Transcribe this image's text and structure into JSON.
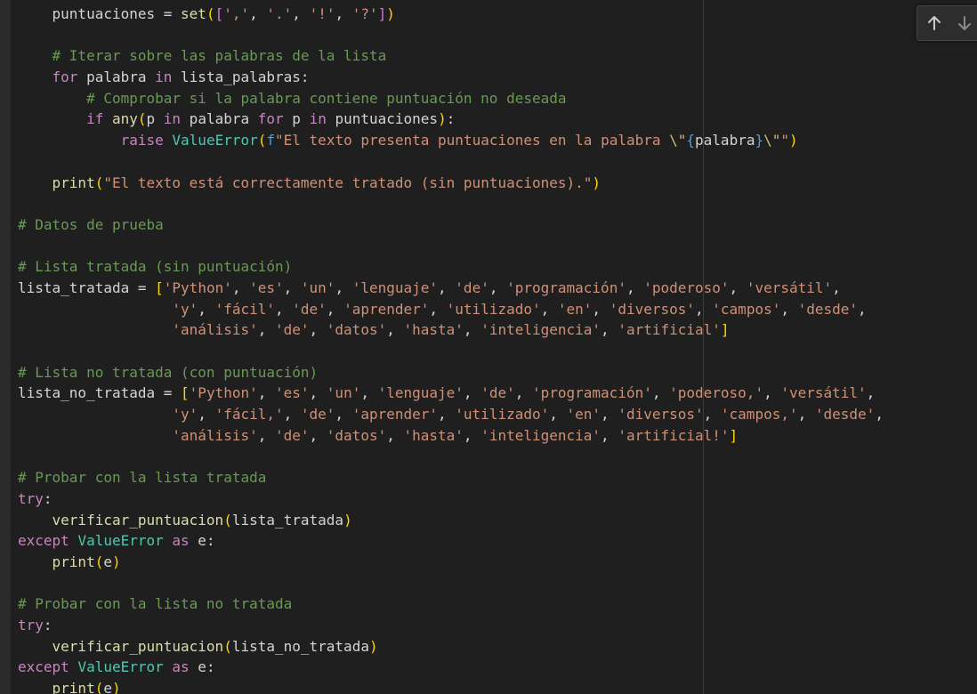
{
  "editor": {
    "lines": [
      [
        [
          "    ",
          ""
        ],
        [
          "puntuaciones",
          "t-v"
        ],
        [
          " = ",
          "t-p"
        ],
        [
          "set",
          "t-f"
        ],
        [
          "(",
          "t-b1"
        ],
        [
          "[",
          "t-b2"
        ],
        [
          "','",
          "t-s"
        ],
        [
          ", ",
          "t-p"
        ],
        [
          "'.'",
          "t-s"
        ],
        [
          ", ",
          "t-p"
        ],
        [
          "'!'",
          "t-s"
        ],
        [
          ", ",
          "t-p"
        ],
        [
          "'?'",
          "t-s"
        ],
        [
          "]",
          "t-b2"
        ],
        [
          ")",
          "t-b1"
        ]
      ],
      [],
      [
        [
          "    ",
          ""
        ],
        [
          "# Iterar sobre las palabras de la lista",
          "t-c"
        ]
      ],
      [
        [
          "    ",
          ""
        ],
        [
          "for",
          "t-cf"
        ],
        [
          " palabra ",
          "t-v"
        ],
        [
          "in",
          "t-cf"
        ],
        [
          " lista_palabras:",
          "t-v"
        ]
      ],
      [
        [
          "        ",
          ""
        ],
        [
          "# Comprobar si la palabra contiene puntuación no deseada",
          "t-c"
        ]
      ],
      [
        [
          "        ",
          ""
        ],
        [
          "if",
          "t-cf"
        ],
        [
          " ",
          ""
        ],
        [
          "any",
          "t-f"
        ],
        [
          "(",
          "t-b1"
        ],
        [
          "p ",
          "t-v"
        ],
        [
          "in",
          "t-cf"
        ],
        [
          " palabra ",
          "t-v"
        ],
        [
          "for",
          "t-cf"
        ],
        [
          " p ",
          "t-v"
        ],
        [
          "in",
          "t-cf"
        ],
        [
          " puntuaciones",
          "t-v"
        ],
        [
          ")",
          "t-b1"
        ],
        [
          ":",
          "t-p"
        ]
      ],
      [
        [
          "            ",
          ""
        ],
        [
          "raise",
          "t-cf"
        ],
        [
          " ",
          ""
        ],
        [
          "ValueError",
          "t-cl"
        ],
        [
          "(",
          "t-b1"
        ],
        [
          "f",
          "t-k"
        ],
        [
          "\"El texto presenta puntuaciones en la palabra ",
          "t-s"
        ],
        [
          "\\\"",
          "t-e"
        ],
        [
          "{",
          "t-k"
        ],
        [
          "palabra",
          "t-v"
        ],
        [
          "}",
          "t-k"
        ],
        [
          "\\\"",
          "t-e"
        ],
        [
          "\"",
          "t-s"
        ],
        [
          ")",
          "t-b1"
        ]
      ],
      [],
      [
        [
          "    ",
          ""
        ],
        [
          "print",
          "t-f"
        ],
        [
          "(",
          "t-b1"
        ],
        [
          "\"El texto está correctamente tratado (sin puntuaciones).\"",
          "t-s"
        ],
        [
          ")",
          "t-b1"
        ]
      ],
      [],
      [
        [
          "# Datos de prueba",
          "t-c"
        ]
      ],
      [],
      [
        [
          "# Lista tratada (sin puntuación)",
          "t-c"
        ]
      ],
      [
        [
          "lista_tratada",
          "t-v"
        ],
        [
          " = ",
          "t-p"
        ],
        [
          "[",
          "t-b1"
        ],
        [
          "'Python'",
          "t-s"
        ],
        [
          ", ",
          "t-p"
        ],
        [
          "'es'",
          "t-s"
        ],
        [
          ", ",
          "t-p"
        ],
        [
          "'un'",
          "t-s"
        ],
        [
          ", ",
          "t-p"
        ],
        [
          "'lenguaje'",
          "t-s"
        ],
        [
          ", ",
          "t-p"
        ],
        [
          "'de'",
          "t-s"
        ],
        [
          ", ",
          "t-p"
        ],
        [
          "'programación'",
          "t-s"
        ],
        [
          ", ",
          "t-p"
        ],
        [
          "'poderoso'",
          "t-s"
        ],
        [
          ", ",
          "t-p"
        ],
        [
          "'versátil'",
          "t-s"
        ],
        [
          ",",
          "t-p"
        ]
      ],
      [
        [
          "                  ",
          ""
        ],
        [
          "'y'",
          "t-s"
        ],
        [
          ", ",
          "t-p"
        ],
        [
          "'fácil'",
          "t-s"
        ],
        [
          ", ",
          "t-p"
        ],
        [
          "'de'",
          "t-s"
        ],
        [
          ", ",
          "t-p"
        ],
        [
          "'aprender'",
          "t-s"
        ],
        [
          ", ",
          "t-p"
        ],
        [
          "'utilizado'",
          "t-s"
        ],
        [
          ", ",
          "t-p"
        ],
        [
          "'en'",
          "t-s"
        ],
        [
          ", ",
          "t-p"
        ],
        [
          "'diversos'",
          "t-s"
        ],
        [
          ", ",
          "t-p"
        ],
        [
          "'campos'",
          "t-s"
        ],
        [
          ", ",
          "t-p"
        ],
        [
          "'desde'",
          "t-s"
        ],
        [
          ",",
          "t-p"
        ]
      ],
      [
        [
          "                  ",
          ""
        ],
        [
          "'análisis'",
          "t-s"
        ],
        [
          ", ",
          "t-p"
        ],
        [
          "'de'",
          "t-s"
        ],
        [
          ", ",
          "t-p"
        ],
        [
          "'datos'",
          "t-s"
        ],
        [
          ", ",
          "t-p"
        ],
        [
          "'hasta'",
          "t-s"
        ],
        [
          ", ",
          "t-p"
        ],
        [
          "'inteligencia'",
          "t-s"
        ],
        [
          ", ",
          "t-p"
        ],
        [
          "'artificial'",
          "t-s"
        ],
        [
          "]",
          "t-b1"
        ]
      ],
      [],
      [
        [
          "# Lista no tratada (con puntuación)",
          "t-c"
        ]
      ],
      [
        [
          "lista_no_tratada",
          "t-v"
        ],
        [
          " = ",
          "t-p"
        ],
        [
          "[",
          "t-b1"
        ],
        [
          "'Python'",
          "t-s"
        ],
        [
          ", ",
          "t-p"
        ],
        [
          "'es'",
          "t-s"
        ],
        [
          ", ",
          "t-p"
        ],
        [
          "'un'",
          "t-s"
        ],
        [
          ", ",
          "t-p"
        ],
        [
          "'lenguaje'",
          "t-s"
        ],
        [
          ", ",
          "t-p"
        ],
        [
          "'de'",
          "t-s"
        ],
        [
          ", ",
          "t-p"
        ],
        [
          "'programación'",
          "t-s"
        ],
        [
          ", ",
          "t-p"
        ],
        [
          "'poderoso,'",
          "t-s"
        ],
        [
          ", ",
          "t-p"
        ],
        [
          "'versátil'",
          "t-s"
        ],
        [
          ",",
          "t-p"
        ]
      ],
      [
        [
          "                  ",
          ""
        ],
        [
          "'y'",
          "t-s"
        ],
        [
          ", ",
          "t-p"
        ],
        [
          "'fácil,'",
          "t-s"
        ],
        [
          ", ",
          "t-p"
        ],
        [
          "'de'",
          "t-s"
        ],
        [
          ", ",
          "t-p"
        ],
        [
          "'aprender'",
          "t-s"
        ],
        [
          ", ",
          "t-p"
        ],
        [
          "'utilizado'",
          "t-s"
        ],
        [
          ", ",
          "t-p"
        ],
        [
          "'en'",
          "t-s"
        ],
        [
          ", ",
          "t-p"
        ],
        [
          "'diversos'",
          "t-s"
        ],
        [
          ", ",
          "t-p"
        ],
        [
          "'campos,'",
          "t-s"
        ],
        [
          ", ",
          "t-p"
        ],
        [
          "'desde'",
          "t-s"
        ],
        [
          ",",
          "t-p"
        ]
      ],
      [
        [
          "                  ",
          ""
        ],
        [
          "'análisis'",
          "t-s"
        ],
        [
          ", ",
          "t-p"
        ],
        [
          "'de'",
          "t-s"
        ],
        [
          ", ",
          "t-p"
        ],
        [
          "'datos'",
          "t-s"
        ],
        [
          ", ",
          "t-p"
        ],
        [
          "'hasta'",
          "t-s"
        ],
        [
          ", ",
          "t-p"
        ],
        [
          "'inteligencia'",
          "t-s"
        ],
        [
          ", ",
          "t-p"
        ],
        [
          "'artificial!'",
          "t-s"
        ],
        [
          "]",
          "t-b1"
        ]
      ],
      [],
      [
        [
          "# Probar con la lista tratada",
          "t-c"
        ]
      ],
      [
        [
          "try",
          "t-cf"
        ],
        [
          ":",
          "t-p"
        ]
      ],
      [
        [
          "    ",
          ""
        ],
        [
          "verificar_puntuacion",
          "t-f"
        ],
        [
          "(",
          "t-b1"
        ],
        [
          "lista_tratada",
          "t-v"
        ],
        [
          ")",
          "t-b1"
        ]
      ],
      [
        [
          "except",
          "t-cf"
        ],
        [
          " ",
          ""
        ],
        [
          "ValueError",
          "t-cl"
        ],
        [
          " ",
          ""
        ],
        [
          "as",
          "t-cf"
        ],
        [
          " e:",
          "t-v"
        ]
      ],
      [
        [
          "    ",
          ""
        ],
        [
          "print",
          "t-f"
        ],
        [
          "(",
          "t-b1"
        ],
        [
          "e",
          "t-v"
        ],
        [
          ")",
          "t-b1"
        ]
      ],
      [],
      [
        [
          "# Probar con la lista no tratada",
          "t-c"
        ]
      ],
      [
        [
          "try",
          "t-cf"
        ],
        [
          ":",
          "t-p"
        ]
      ],
      [
        [
          "    ",
          ""
        ],
        [
          "verificar_puntuacion",
          "t-f"
        ],
        [
          "(",
          "t-b1"
        ],
        [
          "lista_no_tratada",
          "t-v"
        ],
        [
          ")",
          "t-b1"
        ]
      ],
      [
        [
          "except",
          "t-cf"
        ],
        [
          " ",
          ""
        ],
        [
          "ValueError",
          "t-cl"
        ],
        [
          " ",
          ""
        ],
        [
          "as",
          "t-cf"
        ],
        [
          " e:",
          "t-v"
        ]
      ],
      [
        [
          "    ",
          ""
        ],
        [
          "print",
          "t-f"
        ],
        [
          "(",
          "t-b1"
        ],
        [
          "e",
          "t-v"
        ],
        [
          ")",
          "t-b1"
        ]
      ]
    ]
  },
  "find_widget": {
    "previous_icon": "arrow-up-icon",
    "next_icon": "arrow-down-icon"
  },
  "colors": {
    "background": "#1f1f1f",
    "comment": "#6a9955",
    "keyword": "#c586c0",
    "string": "#ce9178",
    "function": "#dcdcaa",
    "class": "#4ec9b0"
  }
}
